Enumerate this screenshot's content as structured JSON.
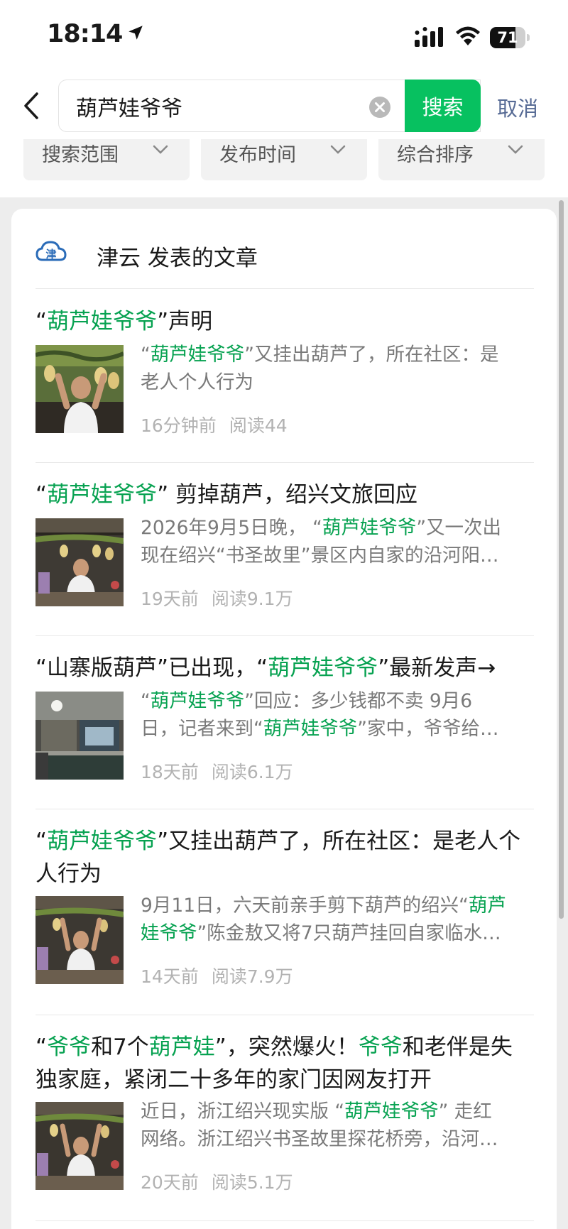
{
  "status_bar": {
    "time": "18:14",
    "battery_level": 71,
    "battery_text": "71"
  },
  "search": {
    "query": "葫芦娃爷爷",
    "button_label": "搜索",
    "cancel_label": "取消"
  },
  "filters": [
    {
      "label": "搜索范围"
    },
    {
      "label": "发布时间"
    },
    {
      "label": "综合排序"
    }
  ],
  "account": {
    "label": "津云 发表的文章"
  },
  "articles": [
    {
      "title": [
        {
          "t": "“"
        },
        {
          "t": "葫芦娃爷爷",
          "hl": true
        },
        {
          "t": "”声明"
        }
      ],
      "summary_lines": [
        [
          {
            "t": "“"
          },
          {
            "t": "葫芦娃爷爷",
            "hl": true
          },
          {
            "t": "”又挂出葫芦了，所在社区：是"
          }
        ],
        [
          {
            "t": "老人个人行为"
          }
        ]
      ],
      "time": "16分钟前",
      "reads": "阅读44"
    },
    {
      "title": [
        {
          "t": "“"
        },
        {
          "t": "葫芦娃爷爷",
          "hl": true
        },
        {
          "t": "” 剪掉葫芦，绍兴文旅回应"
        }
      ],
      "summary_lines": [
        [
          {
            "t": "2026年9月5日晚， “"
          },
          {
            "t": "葫芦娃爷爷",
            "hl": true
          },
          {
            "t": "”又一次出"
          }
        ],
        [
          {
            "t": "现在绍兴“书圣故里”景区内自家的沿河阳…"
          }
        ]
      ],
      "time": "19天前",
      "reads": "阅读9.1万"
    },
    {
      "title": [
        {
          "t": "“山寨版葫芦”已出现，“"
        },
        {
          "t": "葫芦娃爷爷",
          "hl": true
        },
        {
          "t": "”最新发声→"
        }
      ],
      "summary_lines": [
        [
          {
            "t": "“"
          },
          {
            "t": "葫芦娃爷爷",
            "hl": true
          },
          {
            "t": "”回应：多少钱都不卖 9月6"
          }
        ],
        [
          {
            "t": "日，记者来到“"
          },
          {
            "t": "葫芦娃爷爷",
            "hl": true
          },
          {
            "t": "”家中，爷爷给…"
          }
        ]
      ],
      "time": "18天前",
      "reads": "阅读6.1万"
    },
    {
      "title": [
        {
          "t": "“"
        },
        {
          "t": "葫芦娃爷爷",
          "hl": true
        },
        {
          "t": "”又挂出葫芦了，所在社区：是老人个人行为"
        }
      ],
      "summary_lines": [
        [
          {
            "t": "9月11日，六天前亲手剪下葫芦的绍兴“"
          },
          {
            "t": "葫芦",
            "hl": true
          }
        ],
        [
          {
            "t": "娃爷爷",
            "hl": true
          },
          {
            "t": "”陈金敖又将7只葫芦挂回自家临水…"
          }
        ]
      ],
      "time": "14天前",
      "reads": "阅读7.9万"
    },
    {
      "title": [
        {
          "t": "“"
        },
        {
          "t": "爷爷",
          "hl": true
        },
        {
          "t": "和7个"
        },
        {
          "t": "葫芦娃",
          "hl": true
        },
        {
          "t": "”，突然爆火！"
        },
        {
          "t": "爷爷",
          "hl": true
        },
        {
          "t": "和老伴是失独家庭，紧闭二十多年的家门因网友打开"
        }
      ],
      "summary_lines": [
        [
          {
            "t": "近日，浙江绍兴现实版 “"
          },
          {
            "t": "葫芦娃爷爷",
            "hl": true
          },
          {
            "t": "” 走红"
          }
        ],
        [
          {
            "t": "网络。浙江绍兴书圣故里探花桥旁，沿河…"
          }
        ]
      ],
      "time": "20天前",
      "reads": "阅读5.1万"
    }
  ]
}
